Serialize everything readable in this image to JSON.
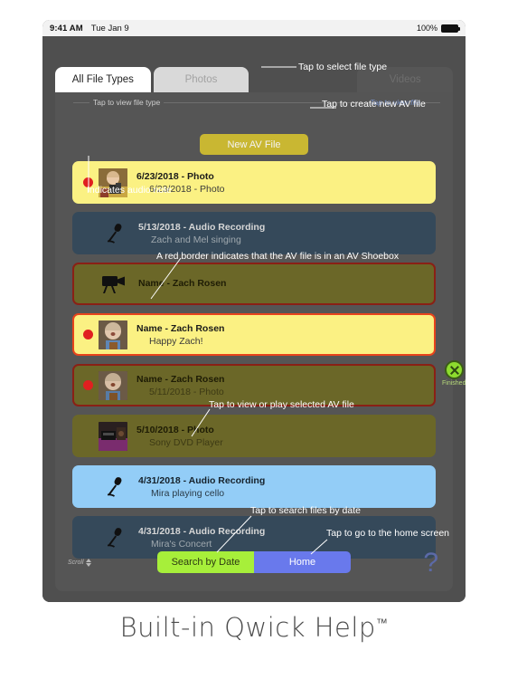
{
  "statusbar": {
    "time": "9:41 AM",
    "date": "Tue Jan 9",
    "battery_pct": "100%"
  },
  "tabs": [
    {
      "label": "All File Types",
      "state": "active"
    },
    {
      "label": "Photos",
      "state": "inactive"
    },
    {
      "label": "Videos",
      "state": "ghost"
    }
  ],
  "hints": {
    "view_file_type": "Tap to view file type",
    "view_file": "Tap to view file"
  },
  "toolbar": {
    "new_av_file_label": "New AV File"
  },
  "list": [
    {
      "title": "6/23/2018 - Photo",
      "subtitle": "6/23/2018 - Photo",
      "style": "yellow",
      "audio_note": true,
      "media": "thumb-child-camera",
      "shoebox": false
    },
    {
      "title": "5/13/2018 - Audio Recording",
      "subtitle": "Zach and Mel singing",
      "style": "dark",
      "audio_note": false,
      "media": "microphone-icon",
      "shoebox": false
    },
    {
      "title": "Name - Zach Rosen",
      "subtitle": "",
      "style": "olive",
      "audio_note": false,
      "media": "video-camera-icon",
      "shoebox": true
    },
    {
      "title": "Name - Zach Rosen",
      "subtitle": "Happy Zach!",
      "style": "sel-yellow",
      "audio_note": true,
      "media": "thumb-child-guitar",
      "shoebox": true
    },
    {
      "title": "Name - Zach Rosen",
      "subtitle": "5/11/2018 - Photo",
      "style": "olive",
      "audio_note": true,
      "media": "thumb-child-guitar",
      "shoebox": true
    },
    {
      "title": "5/10/2018 - Photo",
      "subtitle": "Sony DVD Player",
      "style": "olive",
      "audio_note": false,
      "media": "thumb-dvd-player",
      "shoebox": false
    },
    {
      "title": "4/31/2018 - Audio Recording",
      "subtitle": "Mira playing cello",
      "style": "blue",
      "audio_note": false,
      "media": "microphone-icon",
      "shoebox": false
    },
    {
      "title": "4/31/2018 - Audio Recording",
      "subtitle": "Mira's Concert",
      "style": "dark",
      "audio_note": false,
      "media": "microphone-icon",
      "shoebox": false
    }
  ],
  "finished": {
    "label": "Finished"
  },
  "bottom": {
    "scroll_label": "Scroll",
    "search_label": "Search by Date",
    "home_label": "Home",
    "help_glyph": "?"
  },
  "annotations": {
    "select_file_type": "Tap to select file type",
    "create_new_av_file": "Tap to create new AV file",
    "indicates_audio_note": "Indicates audio note",
    "red_border": "A red border indicates that the  AV file is in an AV Shoebox",
    "view_or_play": "Tap to view or play selected AV file",
    "search_by_date": "Tap to search files by date",
    "home_screen": "Tap to go to the home screen"
  },
  "caption": {
    "text": "Built-in Qwick Help",
    "tm": "™"
  },
  "colors": {
    "accent_yellow": "#fbf183",
    "shoebox_border": "#8a2015",
    "selected_border": "#e8441b",
    "audio_dot": "#e02020",
    "new_file_button": "#c9b732",
    "search_button": "#a7ef3a",
    "home_button": "#6979ec",
    "finished_green": "#8ddc2e"
  }
}
